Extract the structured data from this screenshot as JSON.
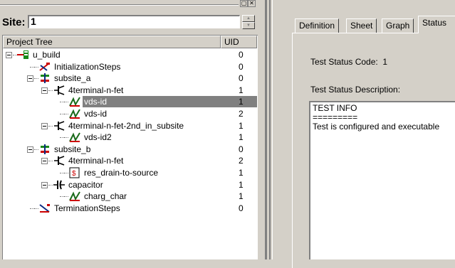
{
  "site": {
    "label": "Site:",
    "value": "1"
  },
  "tree": {
    "columns": {
      "name": "Project Tree",
      "uid": "UID"
    },
    "rows": [
      {
        "label": "u_build",
        "uid": "0",
        "icon": "build-icon"
      },
      {
        "label": "InitializationSteps",
        "uid": "0",
        "icon": "init-steps-icon"
      },
      {
        "label": "subsite_a",
        "uid": "0",
        "icon": "subsite-icon"
      },
      {
        "label": "4terminal-n-fet",
        "uid": "1",
        "icon": "transistor-icon"
      },
      {
        "label": "vds-id",
        "uid": "1",
        "icon": "graph-icon",
        "selected": true
      },
      {
        "label": "vds-id",
        "uid": "2",
        "icon": "graph-icon"
      },
      {
        "label": "4terminal-n-fet-2nd_in_subsite",
        "uid": "1",
        "icon": "transistor-icon"
      },
      {
        "label": "vds-id2",
        "uid": "1",
        "icon": "graph-icon"
      },
      {
        "label": "subsite_b",
        "uid": "0",
        "icon": "subsite-icon"
      },
      {
        "label": "4terminal-n-fet",
        "uid": "2",
        "icon": "transistor-icon"
      },
      {
        "label": "res_drain-to-source",
        "uid": "1",
        "icon": "test-icon"
      },
      {
        "label": "capacitor",
        "uid": "1",
        "icon": "capacitor-icon"
      },
      {
        "label": "charg_char",
        "uid": "1",
        "icon": "graph-icon"
      },
      {
        "label": "TerminationSteps",
        "uid": "0",
        "icon": "term-steps-icon"
      }
    ]
  },
  "tabs": [
    "Definition",
    "Sheet",
    "Graph",
    "Status"
  ],
  "status": {
    "code_label": "Test Status Code:",
    "code_value": "1",
    "description_label": "Test Status Description:",
    "description_text": "TEST INFO\n=========\nTest is configured and executable"
  },
  "colors": {
    "selection": "#808080",
    "face": "#d4d0c8"
  }
}
